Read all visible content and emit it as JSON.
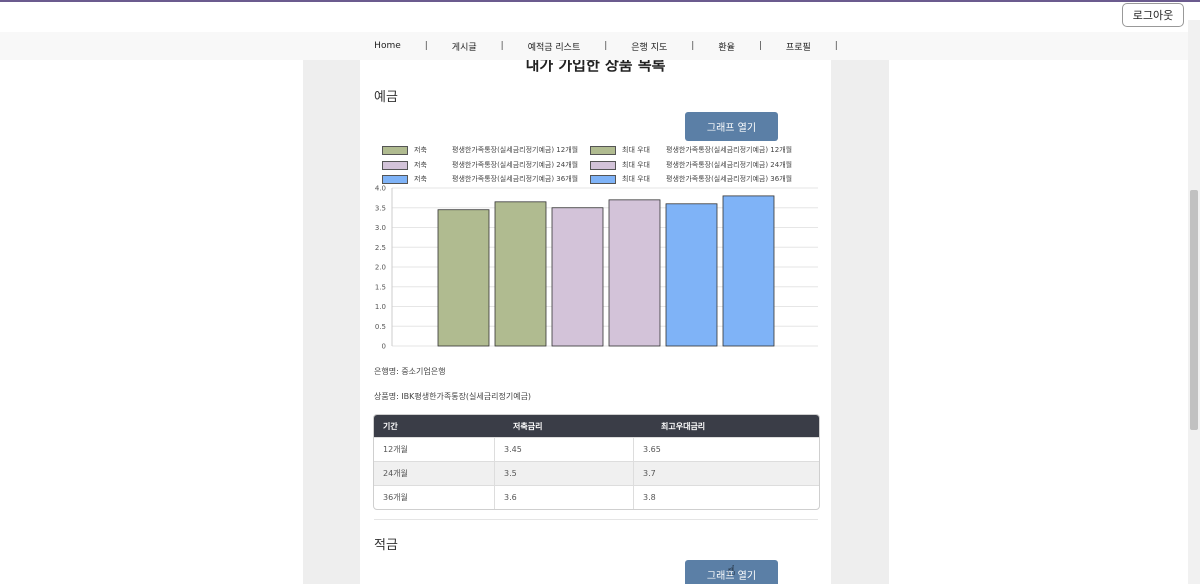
{
  "header": {
    "logout_label": "로그아웃"
  },
  "nav": {
    "items": [
      "Home",
      "게시글",
      "예적금 리스트",
      "은행 지도",
      "환율",
      "프로필"
    ],
    "separator": "|"
  },
  "page": {
    "title": "내가 가입한 상품 목록"
  },
  "deposit_section": {
    "title": "예금",
    "graph_button": "그래프 열기",
    "legend": [
      {
        "label": "저축",
        "product": "평생한가족통장(실세금리정기예금) 12개월",
        "color": "#b0bb90"
      },
      {
        "label": "최대 우대",
        "product": "평생한가족통장(실세금리정기예금) 12개월",
        "color": "#b0bb90"
      },
      {
        "label": "저축",
        "product": "평생한가족통장(실세금리정기예금) 24개월",
        "color": "#d3c3d9"
      },
      {
        "label": "최대 우대",
        "product": "평생한가족통장(실세금리정기예금) 24개월",
        "color": "#d3c3d9"
      },
      {
        "label": "저축",
        "product": "평생한가족통장(실세금리정기예금) 36개월",
        "color": "#7fb3f7"
      },
      {
        "label": "최대 우대",
        "product": "평생한가족통장(실세금리정기예금) 36개월",
        "color": "#7fb3f7"
      }
    ],
    "bank_name": "은행명: 중소기업은행",
    "product_name": "상품명: IBK평생한가족통장(실세금리정기예금)",
    "table": {
      "headers": [
        "기간",
        "저축금리",
        "최고우대금리"
      ],
      "rows": [
        [
          "12개월",
          "3.45",
          "3.65"
        ],
        [
          "24개월",
          "3.5",
          "3.7"
        ],
        [
          "36개월",
          "3.6",
          "3.8"
        ]
      ]
    }
  },
  "savings_section": {
    "title": "적금",
    "graph_button": "그래프 열기"
  },
  "chart_data": {
    "type": "bar",
    "categories": [
      "12개월 저축",
      "12개월 최대 우대",
      "24개월 저축",
      "24개월 최대 우대",
      "36개월 저축",
      "36개월 최대 우대"
    ],
    "values": [
      3.45,
      3.65,
      3.5,
      3.7,
      3.6,
      3.8
    ],
    "colors": [
      "#b0bb90",
      "#b0bb90",
      "#d3c3d9",
      "#d3c3d9",
      "#7fb3f7",
      "#7fb3f7"
    ],
    "ylim": [
      0,
      4.0
    ],
    "yticks": [
      "0",
      "0.5",
      "1.0",
      "1.5",
      "2.0",
      "2.5",
      "3.0",
      "3.5",
      "4.0"
    ],
    "grid": true
  }
}
